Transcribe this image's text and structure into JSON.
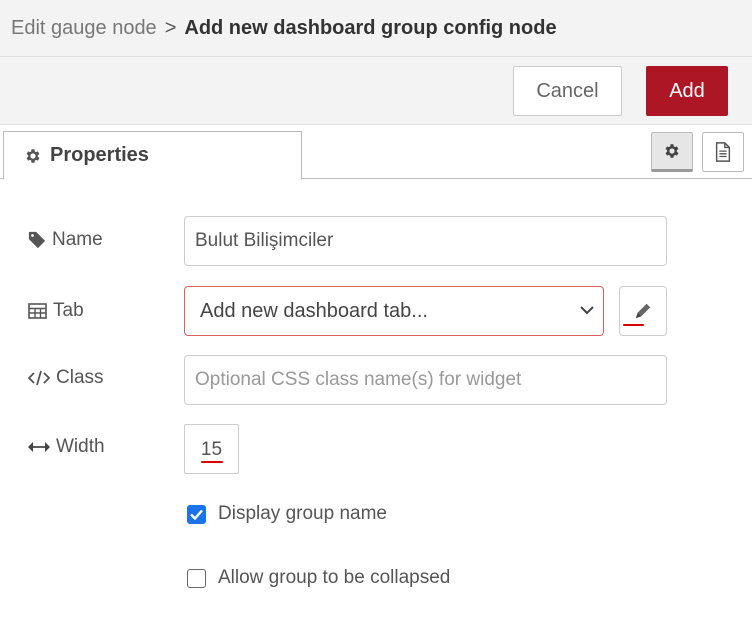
{
  "header": {
    "breadcrumb_parent": "Edit gauge node",
    "separator": ">",
    "title": "Add new dashboard group config node"
  },
  "actions": {
    "cancel_label": "Cancel",
    "add_label": "Add",
    "add_color": "#ad1625"
  },
  "tabs": {
    "properties_label": "Properties"
  },
  "form": {
    "name": {
      "label": "Name",
      "value": "Bulut Bilişimciler"
    },
    "tab": {
      "label": "Tab",
      "selected": "Add new dashboard tab..."
    },
    "class": {
      "label": "Class",
      "placeholder": "Optional CSS class name(s) for widget"
    },
    "width": {
      "label": "Width",
      "value": "15"
    },
    "display_group_name": {
      "label": "Display group name",
      "checked": true
    },
    "allow_collapse": {
      "label": "Allow group to be collapsed",
      "checked": false
    }
  },
  "icons": {
    "properties_tab": "gear-icon",
    "settings_tab": "gear-icon",
    "info_tab": "document-icon",
    "name": "tag-icon",
    "tab": "table-icon",
    "class": "code-icon",
    "width": "horizontal-arrows-icon",
    "edit": "pencil-icon"
  }
}
